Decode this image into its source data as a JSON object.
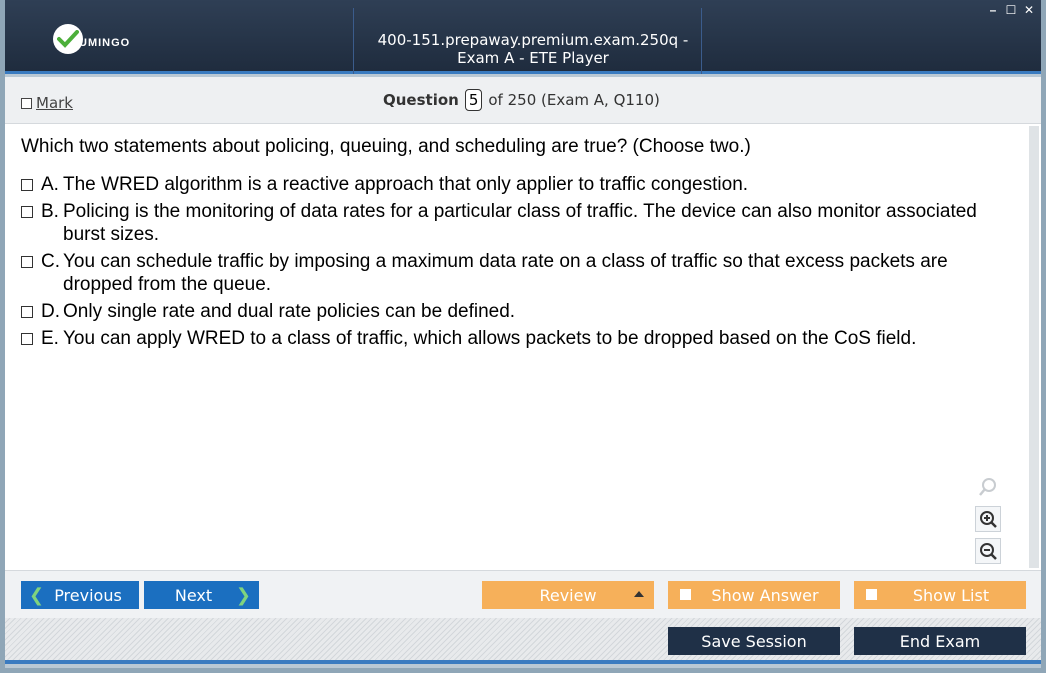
{
  "window": {
    "title": "400-151.prepaway.premium.exam.250q - Exam A - ETE Player",
    "logo_text": "UMINGO",
    "controls": [
      "minimize",
      "maximize",
      "close"
    ]
  },
  "header": {
    "mark_label": "Mark",
    "question_label": "Question",
    "question_number": "5",
    "question_of": "of 250 (Exam A, Q110)"
  },
  "question": {
    "text": "Which two statements about policing, queuing, and scheduling are true? (Choose two.)",
    "options": [
      {
        "letter": "A.",
        "text": "The WRED algorithm is a reactive approach that only applier to traffic congestion."
      },
      {
        "letter": "B.",
        "text": "Policing is the monitoring of data rates for a particular class of traffic. The device can also monitor associated burst sizes."
      },
      {
        "letter": "C.",
        "text": "You can schedule traffic by imposing a maximum data rate on a class of traffic so that excess packets are dropped from the queue."
      },
      {
        "letter": "D.",
        "text": "Only single rate and dual rate policies can be defined."
      },
      {
        "letter": "E.",
        "text": "You can apply WRED to a class of traffic, which allows packets to be dropped based on the CoS field."
      }
    ]
  },
  "zoom": {
    "icons": [
      "search-icon",
      "zoom-in-icon",
      "zoom-out-icon"
    ]
  },
  "nav": {
    "previous": "Previous",
    "next": "Next",
    "review": "Review",
    "show_answer": "Show Answer",
    "show_list": "Show List"
  },
  "footer": {
    "save_session": "Save Session",
    "end_exam": "End Exam"
  },
  "colors": {
    "title_bg": "#1f2c3e",
    "accent_blue": "#1b6fc0",
    "orange": "#f6b05a",
    "dark_button": "#1f3047",
    "logo_green": "#4caf3a"
  }
}
